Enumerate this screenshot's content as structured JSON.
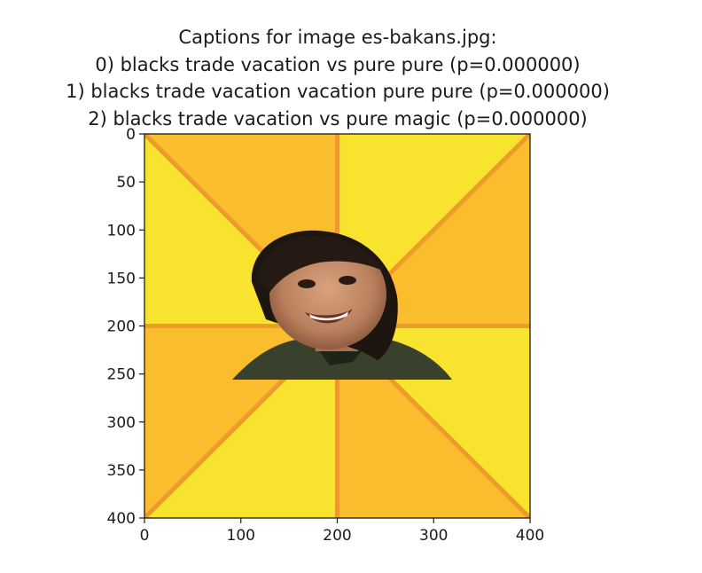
{
  "chart_data": {
    "type": "image",
    "title_lines": [
      "Captions for image es-bakans.jpg:",
      "0) blacks trade vacation vs pure pure (p=0.000000)",
      "1) blacks trade vacation vacation pure pure (p=0.000000)",
      "2) blacks trade vacation vs pure magic (p=0.000000)"
    ],
    "xlim": [
      0,
      400
    ],
    "ylim": [
      400,
      0
    ],
    "xticks": [
      0,
      100,
      200,
      300,
      400
    ],
    "yticks": [
      0,
      50,
      100,
      150,
      200,
      250,
      300,
      350,
      400
    ],
    "image_content": {
      "background": "yellow-orange sunburst",
      "subject": "smiling child",
      "colors": {
        "yellow": "#f8e42e",
        "orange": "#f9bd2d",
        "ray": "#ee9a2c"
      }
    }
  }
}
